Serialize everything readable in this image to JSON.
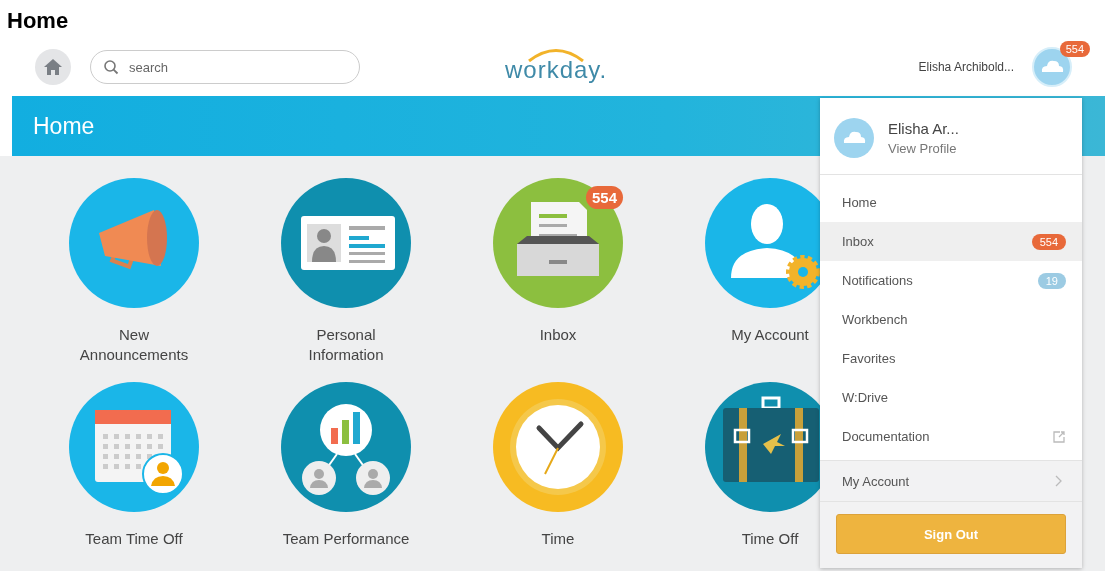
{
  "page_title": "Home",
  "topbar": {
    "search": {
      "placeholder": "search"
    },
    "logo": "workday.",
    "user_name": "Elisha Archibold...",
    "avatar_badge": "554"
  },
  "banner": {
    "title": "Home"
  },
  "tiles": [
    {
      "label": "New Announcements",
      "kind": "megaphone"
    },
    {
      "label": "Personal Information",
      "kind": "id-card"
    },
    {
      "label": "Inbox",
      "kind": "inbox",
      "badge": "554"
    },
    {
      "label": "My Account",
      "kind": "account"
    },
    {
      "label": "Team Time Off",
      "kind": "calendar"
    },
    {
      "label": "Team Performance",
      "kind": "team"
    },
    {
      "label": "Time",
      "kind": "clock"
    },
    {
      "label": "Time Off",
      "kind": "suitcase"
    }
  ],
  "menu": {
    "name": "Elisha Ar...",
    "profile_link": "View Profile",
    "items": [
      {
        "label": "Home",
        "selected": false
      },
      {
        "label": "Inbox",
        "selected": true,
        "badge": "554",
        "color": "#e8693a"
      },
      {
        "label": "Notifications",
        "selected": false,
        "badge": "19",
        "color": "#9ccbe3"
      },
      {
        "label": "Workbench",
        "selected": false
      },
      {
        "label": "Favorites",
        "selected": false
      },
      {
        "label": "W:Drive",
        "selected": false
      },
      {
        "label": "Documentation",
        "selected": false,
        "external": true
      }
    ],
    "account": "My Account",
    "sign_out": "Sign Out"
  }
}
